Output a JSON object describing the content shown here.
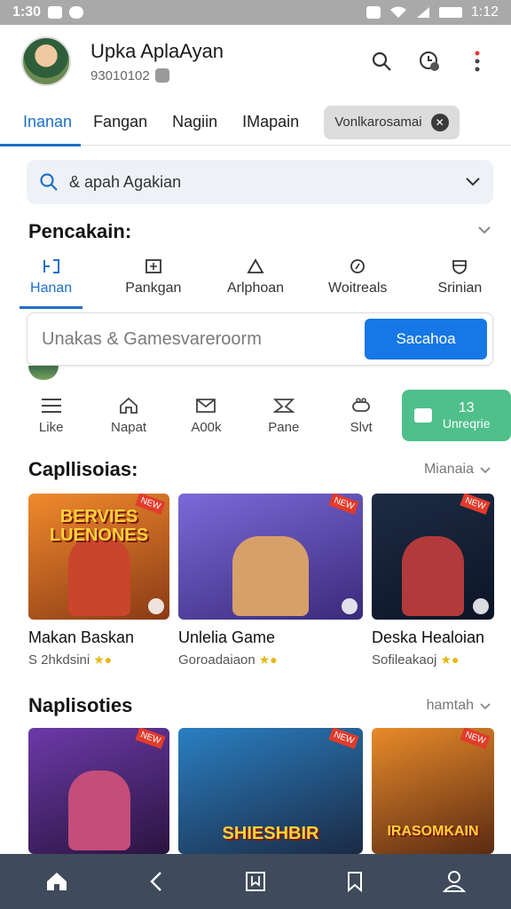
{
  "status_bar": {
    "time": "1:30",
    "right_time": "1:12"
  },
  "header": {
    "user_name": "Upka AplaAyan",
    "user_sub": "93010102",
    "icons": [
      "search-icon",
      "history-icon",
      "more-vert-icon"
    ]
  },
  "tabs": {
    "items": [
      "Inanan",
      "Fangan",
      "Nagiin",
      "IMapain"
    ],
    "pill_label": "Vonlkarosamai"
  },
  "search": {
    "text": "& apah Agakian"
  },
  "categories_section": {
    "title": "Pencakain:",
    "items": [
      {
        "label": "Hanan",
        "icon": "grid-icon"
      },
      {
        "label": "Pankgan",
        "icon": "box-icon"
      },
      {
        "label": "Arlphoan",
        "icon": "triangle-icon"
      },
      {
        "label": "Woitreals",
        "icon": "circle-icon"
      },
      {
        "label": "Srinian",
        "icon": "shield-icon"
      }
    ]
  },
  "game_search": {
    "placeholder": "Unakas & Gamesvareroorm",
    "button": "Sacahoa"
  },
  "tools": {
    "items": [
      {
        "label": "Like",
        "icon": "menu-icon"
      },
      {
        "label": "Napat",
        "icon": "home-icon"
      },
      {
        "label": "A00k",
        "icon": "mail-icon"
      },
      {
        "label": "Pane",
        "icon": "envelope-icon"
      },
      {
        "label": "Slvt",
        "icon": "gamepad-icon"
      }
    ],
    "highlight": {
      "number": "13",
      "label": "Unreqrie"
    }
  },
  "section1": {
    "title": "Capllisoias:",
    "more": "Mianaia",
    "cards": [
      {
        "title": "Makan Baskan",
        "sub": "S 2hkdsini",
        "banner": "BERVIES LUENONES",
        "colors": [
          "#f08a2c",
          "#8a3a16"
        ]
      },
      {
        "title": "Unlelia Game",
        "sub": "Goroadaiaon",
        "banner": "",
        "colors": [
          "#7b6ad9",
          "#3a2a7a"
        ]
      },
      {
        "title": "Deska Healoian",
        "sub": "Sofileakaoj",
        "banner": "",
        "colors": [
          "#1e2b44",
          "#0c1526"
        ]
      }
    ]
  },
  "section2": {
    "title": "Naplisoties",
    "more": "hamtah",
    "cards": [
      {
        "banner": "",
        "colors": [
          "#6c3aa8",
          "#2a1440"
        ]
      },
      {
        "banner": "SHIESHBIR",
        "colors": [
          "#2a7fc2",
          "#1b2a44"
        ]
      },
      {
        "banner": "IRASOMKAIN",
        "colors": [
          "#e88b2a",
          "#5a2a12"
        ]
      }
    ]
  },
  "bottom_nav": [
    "home-icon",
    "back-icon",
    "bookmark-box-icon",
    "bookmark-icon",
    "profile-icon"
  ]
}
